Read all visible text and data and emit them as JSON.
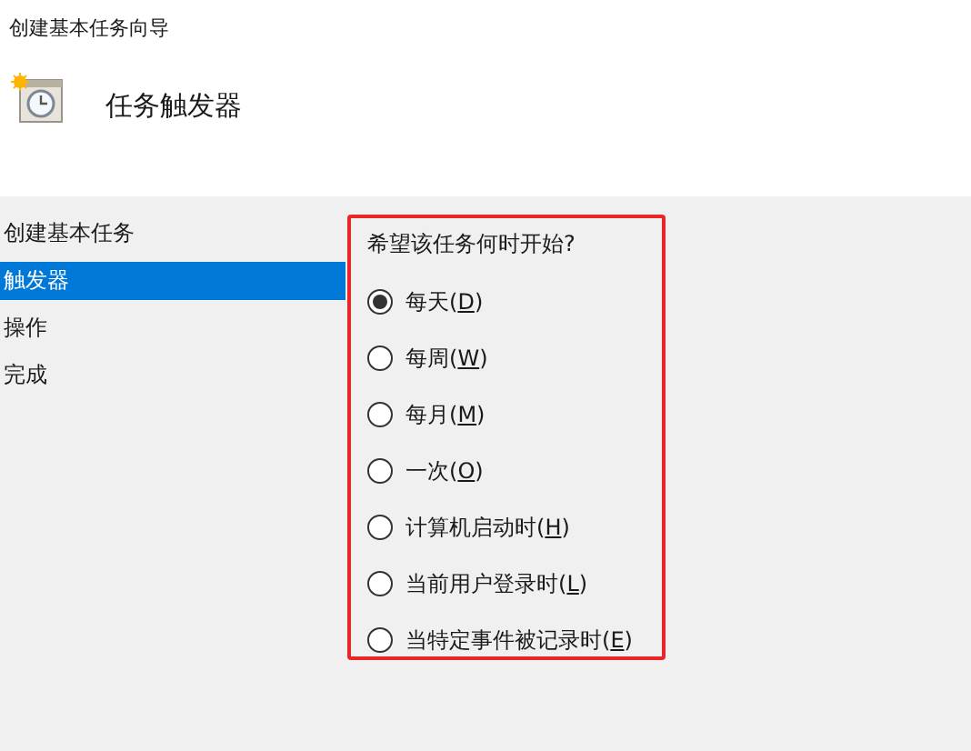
{
  "window": {
    "title": "创建基本任务向导"
  },
  "header": {
    "title": "任务触发器"
  },
  "sidebar": {
    "items": [
      {
        "label": "创建基本任务",
        "selected": false
      },
      {
        "label": "触发器",
        "selected": true
      },
      {
        "label": "操作",
        "selected": false
      },
      {
        "label": "完成",
        "selected": false
      }
    ]
  },
  "question": "希望该任务何时开始?",
  "options": [
    {
      "label_before": "每天(",
      "access_key": "D",
      "label_after": ")",
      "selected": true
    },
    {
      "label_before": "每周(",
      "access_key": "W",
      "label_after": ")",
      "selected": false
    },
    {
      "label_before": "每月(",
      "access_key": "M",
      "label_after": ")",
      "selected": false
    },
    {
      "label_before": "一次(",
      "access_key": "O",
      "label_after": ")",
      "selected": false
    },
    {
      "label_before": "计算机启动时(",
      "access_key": "H",
      "label_after": ")",
      "selected": false
    },
    {
      "label_before": "当前用户登录时(",
      "access_key": "L",
      "label_after": ")",
      "selected": false
    },
    {
      "label_before": "当特定事件被记录时(",
      "access_key": "E",
      "label_after": ")",
      "selected": false
    }
  ]
}
